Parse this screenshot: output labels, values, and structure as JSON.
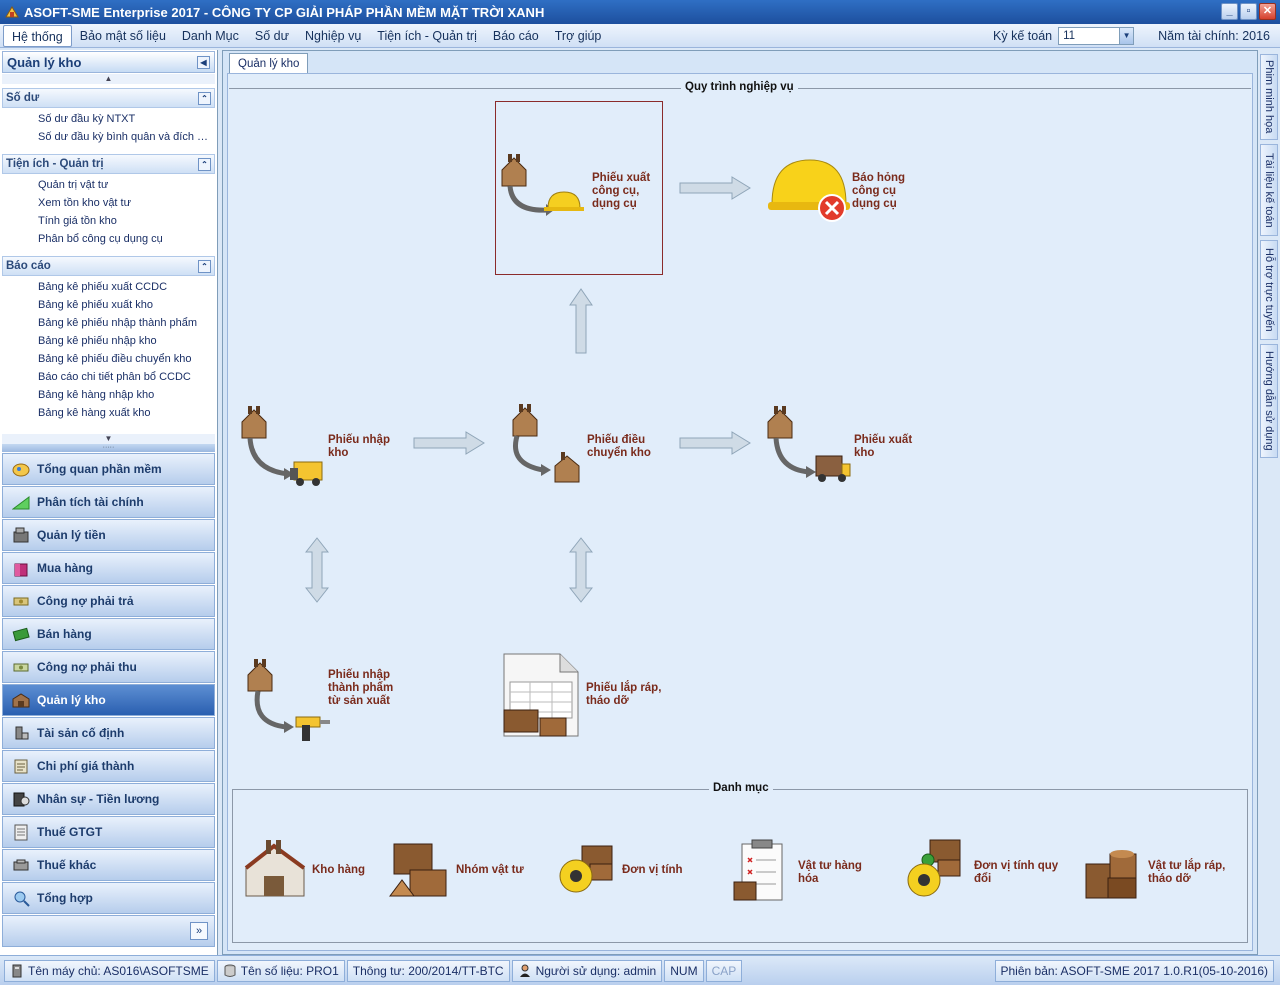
{
  "window": {
    "title": "ASOFT-SME Enterprise 2017 - CÔNG TY CP GIẢI PHÁP PHẦN MỀM MẶT TRỜI XANH"
  },
  "menu": {
    "items": [
      "Hệ thống",
      "Bảo mật số liệu",
      "Danh Mục",
      "Số dư",
      "Nghiệp vụ",
      "Tiện ích - Quản trị",
      "Báo cáo",
      "Trợ giúp"
    ],
    "period_label": "Kỳ kế toán",
    "period_value": "11",
    "fiscal_year": "Năm tài chính: 2016"
  },
  "sidebar": {
    "title": "Quản lý kho",
    "groups": [
      {
        "title": "Số dư",
        "items": [
          "Số dư đầu kỳ NTXT",
          "Số dư đầu kỳ bình quân và đích danh"
        ]
      },
      {
        "title": "Tiện ích - Quản trị",
        "items": [
          "Quản trị vật tư",
          "Xem tồn kho vật tư",
          "Tính giá tồn kho",
          "Phân bổ công cụ dụng cụ"
        ]
      },
      {
        "title": "Báo cáo",
        "items": [
          "Bảng kê phiếu xuất CCDC",
          "Bảng kê phiếu xuất kho",
          "Bảng kê phiếu nhập thành phẩm",
          "Bảng kê phiếu nhập kho",
          "Bảng kê phiếu điều chuyển kho",
          "Báo cáo chi tiết phân bổ CCDC",
          "Bảng kê hàng nhập kho",
          "Bảng kê hàng xuất kho"
        ]
      }
    ],
    "nav": [
      "Tổng quan phần mềm",
      "Phân tích tài chính",
      "Quản lý tiền",
      "Mua hàng",
      "Công nợ phải trả",
      "Bán hàng",
      "Công nợ phải thu",
      "Quản lý kho",
      "Tài sản cố định",
      "Chi phí giá thành",
      "Nhân sự - Tiền lương",
      "Thuế GTGT",
      "Thuế khác",
      "Tổng hợp"
    ],
    "nav_active": "Quản lý kho"
  },
  "tab": {
    "label": "Quản lý kho"
  },
  "process": {
    "title": "Quy trình nghiệp vụ",
    "nodes": {
      "xuat_ccdc": "Phiếu xuất công cụ, dụng cụ",
      "bao_hong": "Báo hỏng công cụ dụng cụ",
      "nhap_kho": "Phiếu nhập kho",
      "dieu_chuyen": "Phiếu điều chuyển kho",
      "xuat_kho": "Phiếu xuất kho",
      "nhap_thanh_pham": "Phiếu nhập thành phẩm từ sản xuất",
      "lap_rap": "Phiếu lắp ráp, tháo dỡ"
    }
  },
  "catalog": {
    "title": "Danh mục",
    "items": [
      "Kho hàng",
      "Nhóm vật tư",
      "Đơn vị tính",
      "Vật tư hàng hóa",
      "Đơn vị tính quy đổi",
      "Vật tư lắp ráp, tháo dỡ"
    ]
  },
  "right_tabs": [
    "Phim minh họa",
    "Tài liệu kế toán",
    "Hỗ trợ trực tuyến",
    "Hướng dẫn sử dụng"
  ],
  "status": {
    "machine": "Tên máy chủ: AS016\\ASOFTSME",
    "database": "Tên số liệu: PRO1",
    "circular": "Thông tư: 200/2014/TT-BTC",
    "user": "Người sử dụng: admin",
    "num": "NUM",
    "cap": "CAP",
    "version": "Phiên bản:  ASOFT-SME 2017 1.0.R1(05-10-2016)"
  },
  "colors": {
    "accent": "#2a5fb0",
    "node_label": "#7a2b1c",
    "selection": "#8b2b2b"
  }
}
